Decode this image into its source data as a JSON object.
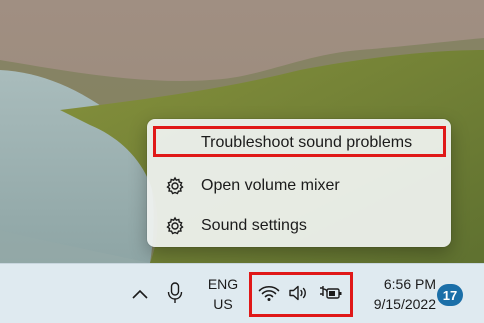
{
  "context_menu": {
    "items": [
      {
        "label": "Troubleshoot sound problems",
        "icon": "none"
      },
      {
        "label": "Open volume mixer",
        "icon": "gear-icon"
      },
      {
        "label": "Sound settings",
        "icon": "gear-icon"
      }
    ]
  },
  "taskbar": {
    "language": {
      "line1": "ENG",
      "line2": "US"
    },
    "clock": {
      "time": "6:56 PM",
      "date": "9/15/2022"
    },
    "notification_count": "17",
    "icons": [
      "chevron-up-icon",
      "microphone-icon",
      "wifi-icon",
      "speaker-icon",
      "battery-charging-icon"
    ]
  },
  "colors": {
    "highlight": "#e01818",
    "taskbar_bg": "#dfeaf0",
    "badge": "#1b6fa8",
    "menu_bg": "#f0f3f1"
  }
}
